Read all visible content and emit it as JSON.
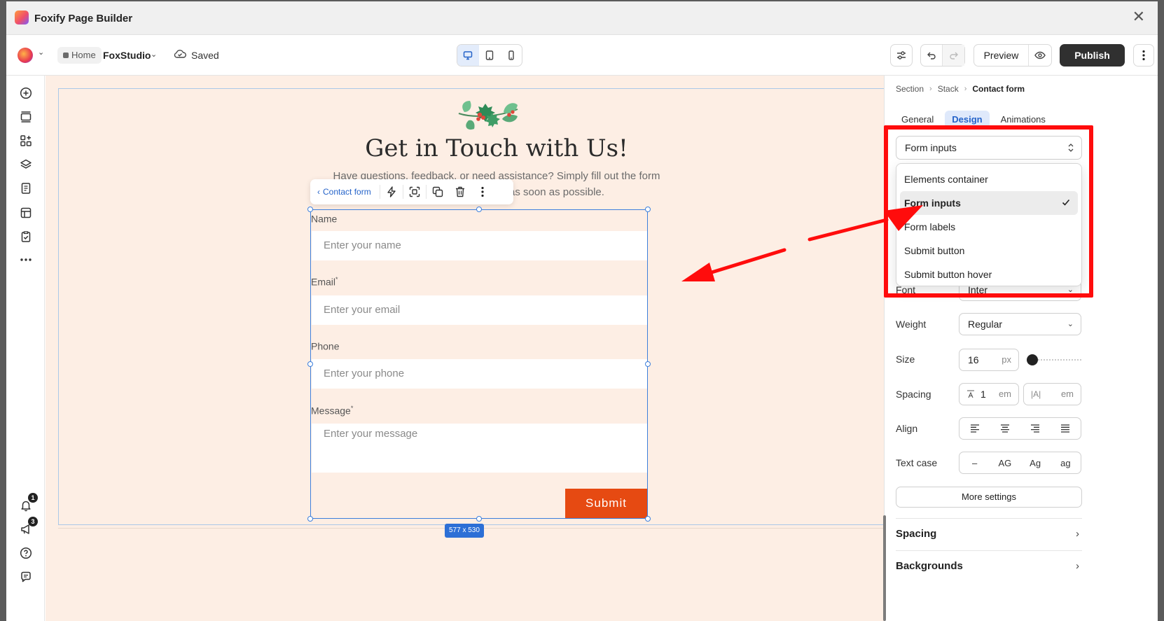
{
  "window": {
    "title": "Foxify Page Builder"
  },
  "topbar": {
    "breadcrumb_home": "Home",
    "store_name": "FoxStudio",
    "saved_label": "Saved",
    "preview_label": "Preview",
    "publish_label": "Publish"
  },
  "left_rail": {
    "notifications_badge": "1",
    "announcements_badge": "3"
  },
  "canvas": {
    "heading": "Get in Touch with Us!",
    "subtext_line1": "Have questions, feedback, or need assistance? Simply fill out the form",
    "subtext_line2": "as soon as possible.",
    "element_toolbar_label": "Contact form",
    "size_badge": "577 x 530",
    "form": {
      "fields": [
        {
          "label": "Name",
          "required": "",
          "placeholder": "Enter your name"
        },
        {
          "label": "Email",
          "required": "*",
          "placeholder": "Enter your email"
        },
        {
          "label": "Phone",
          "required": "",
          "placeholder": "Enter your phone"
        },
        {
          "label": "Message",
          "required": "*",
          "placeholder": "Enter your message"
        }
      ],
      "submit_label": "Submit"
    }
  },
  "panel": {
    "breadcrumb": [
      "Section",
      "Stack",
      "Contact form"
    ],
    "tabs": [
      "General",
      "Design",
      "Animations"
    ],
    "active_tab": "Design",
    "target_select": "Form inputs",
    "target_options": [
      "Elements container",
      "Form inputs",
      "Form labels",
      "Submit button",
      "Submit button hover"
    ],
    "font_label": "Font",
    "font_value": "Inter",
    "weight_label": "Weight",
    "weight_value": "Regular",
    "size_label": "Size",
    "size_value": "16",
    "size_unit": "px",
    "size_slider_fraction": 0.05,
    "spacing_label": "Spacing",
    "letter_spacing_value": "1",
    "line_height_value": "",
    "spacing_unit": "em",
    "align_label": "Align",
    "text_case_label": "Text case",
    "text_case_options": [
      "–",
      "AG",
      "Ag",
      "ag"
    ],
    "more_settings_label": "More settings",
    "accordions": [
      "Spacing",
      "Backgrounds"
    ]
  },
  "colors": {
    "accent": "#2563c9",
    "submit": "#e64a12",
    "canvas_bg": "#fdeee4",
    "annotation": "#ff0c0c"
  }
}
